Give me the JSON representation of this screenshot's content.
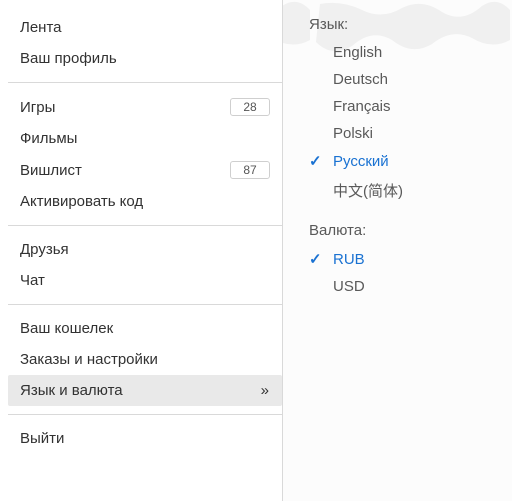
{
  "left_menu": {
    "groups": [
      [
        {
          "id": "feed",
          "label": "Лента",
          "badge": null,
          "active": false
        },
        {
          "id": "profile",
          "label": "Ваш профиль",
          "badge": null,
          "active": false
        }
      ],
      [
        {
          "id": "games",
          "label": "Игры",
          "badge": "28",
          "active": false
        },
        {
          "id": "movies",
          "label": "Фильмы",
          "badge": null,
          "active": false
        },
        {
          "id": "wishlist",
          "label": "Вишлист",
          "badge": "87",
          "active": false
        },
        {
          "id": "redeem",
          "label": "Активировать код",
          "badge": null,
          "active": false
        }
      ],
      [
        {
          "id": "friends",
          "label": "Друзья",
          "badge": null,
          "active": false
        },
        {
          "id": "chat",
          "label": "Чат",
          "badge": null,
          "active": false
        }
      ],
      [
        {
          "id": "wallet",
          "label": "Ваш кошелек",
          "badge": null,
          "active": false
        },
        {
          "id": "orders",
          "label": "Заказы и настройки",
          "badge": null,
          "active": false
        },
        {
          "id": "lang-currency",
          "label": "Язык и валюта",
          "badge": null,
          "active": true,
          "chevron": true
        }
      ],
      [
        {
          "id": "logout",
          "label": "Выйти",
          "badge": null,
          "active": false
        }
      ]
    ]
  },
  "right_panel": {
    "language": {
      "title": "Язык:",
      "options": [
        {
          "id": "en",
          "label": "English",
          "selected": false
        },
        {
          "id": "de",
          "label": "Deutsch",
          "selected": false
        },
        {
          "id": "fr",
          "label": "Français",
          "selected": false
        },
        {
          "id": "pl",
          "label": "Polski",
          "selected": false
        },
        {
          "id": "ru",
          "label": "Русский",
          "selected": true
        },
        {
          "id": "zh",
          "label": "中文(简体)",
          "selected": false
        }
      ]
    },
    "currency": {
      "title": "Валюта:",
      "options": [
        {
          "id": "rub",
          "label": "RUB",
          "selected": true
        },
        {
          "id": "usd",
          "label": "USD",
          "selected": false
        }
      ]
    }
  }
}
